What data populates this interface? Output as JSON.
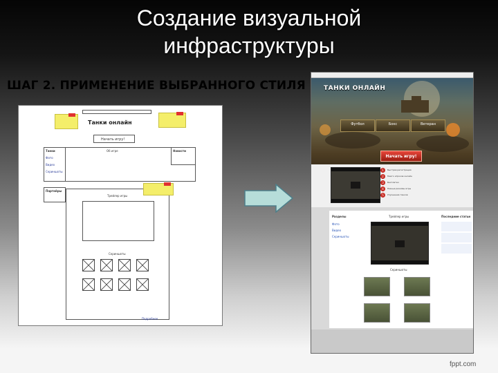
{
  "slide": {
    "title": "Создание визуальной инфраструктуры",
    "step_heading": "ШАГ 2. ПРИМЕНЕНИЕ ВЫБРАННОГО СТИЛЯ",
    "watermark": "fppt.com"
  },
  "wireframe": {
    "logo": "Танки онлайн",
    "play_button": "Начать игру!",
    "left_nav_title": "Танки",
    "left_nav_items": [
      "Фото",
      "Видео",
      "Скриншоты"
    ],
    "partners_title": "Партнёры",
    "main_title": "Об игре",
    "news_title": "Новости",
    "video_title": "Трейлер игры",
    "screens_title": "Скриншоты",
    "footer_link": "Подробнее"
  },
  "site": {
    "logo": "ТАНКИ ОНЛАЙН",
    "tabs": [
      {
        "label": "Футбол"
      },
      {
        "label": "Бокс"
      },
      {
        "label": "Ветеран"
      }
    ],
    "play_button": "Начать игру!",
    "features": [
      "Быстрая регистрация",
      "Много игроков онлайн",
      "Бесплатно",
      "Разные режимы игры",
      "Улучшение танков"
    ],
    "left_col_title": "Разделы",
    "left_col_links": [
      "Фото",
      "Видео",
      "Скриншоты"
    ],
    "middle_title": "Трейлер игры",
    "right_title": "Последние статьи",
    "screens_title": "Скриншоты"
  },
  "colors": {
    "accent": "#c62a22",
    "sticky_note": "#f4ee6a",
    "arrow_fill": "#b6ddd9",
    "link": "#2a56b8"
  }
}
